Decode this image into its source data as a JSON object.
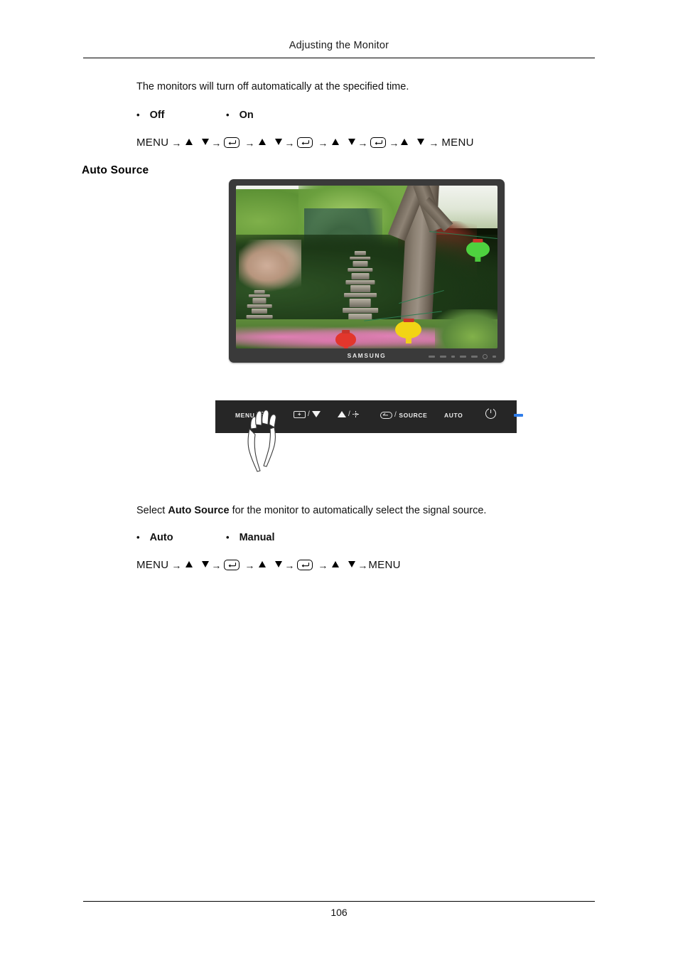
{
  "header": {
    "title": "Adjusting the Monitor"
  },
  "footer": {
    "page_number": "106"
  },
  "content": {
    "intro_text": "The monitors will turn off automatically at the specified time.",
    "options_top": [
      {
        "label": "Off"
      },
      {
        "label": "On"
      }
    ],
    "nav_sequence_top": {
      "start_label": "MENU",
      "end_label": "MENU"
    },
    "section_heading": "Auto Source",
    "select_prefix": "Select ",
    "select_bold": "Auto Source",
    "select_suffix": " for the monitor to automatically select the signal source.",
    "options_bottom": [
      {
        "label": "Auto"
      },
      {
        "label": "Manual"
      }
    ],
    "nav_sequence_bottom": {
      "start_label": "MENU",
      "end_label": "MENU"
    }
  },
  "figure_monitor": {
    "brand_logo": "SAMSUNG",
    "screen_description": "Garden scene with stone pagodas, trees and colored lanterns"
  },
  "figure_button_panel": {
    "buttons": [
      {
        "name": "menu",
        "label": "MENU",
        "icon": "menu-lines-icon"
      },
      {
        "name": "down",
        "label": "",
        "icon": "magnify-plus-icon",
        "separator": "/",
        "icon2": "triangle-down-icon"
      },
      {
        "name": "up",
        "label": "",
        "icon": "triangle-up-icon",
        "separator": "/",
        "icon2": "brightness-sun-icon"
      },
      {
        "name": "source",
        "label": "SOURCE",
        "icon": "enter-key-icon",
        "separator": "/"
      },
      {
        "name": "auto",
        "label": "AUTO",
        "icon": ""
      },
      {
        "name": "power",
        "label": "",
        "icon": "power-icon"
      },
      {
        "name": "led",
        "label": "",
        "icon": "led-indicator"
      }
    ],
    "led_color": "#2f7dea",
    "panel_color": "#262626"
  }
}
